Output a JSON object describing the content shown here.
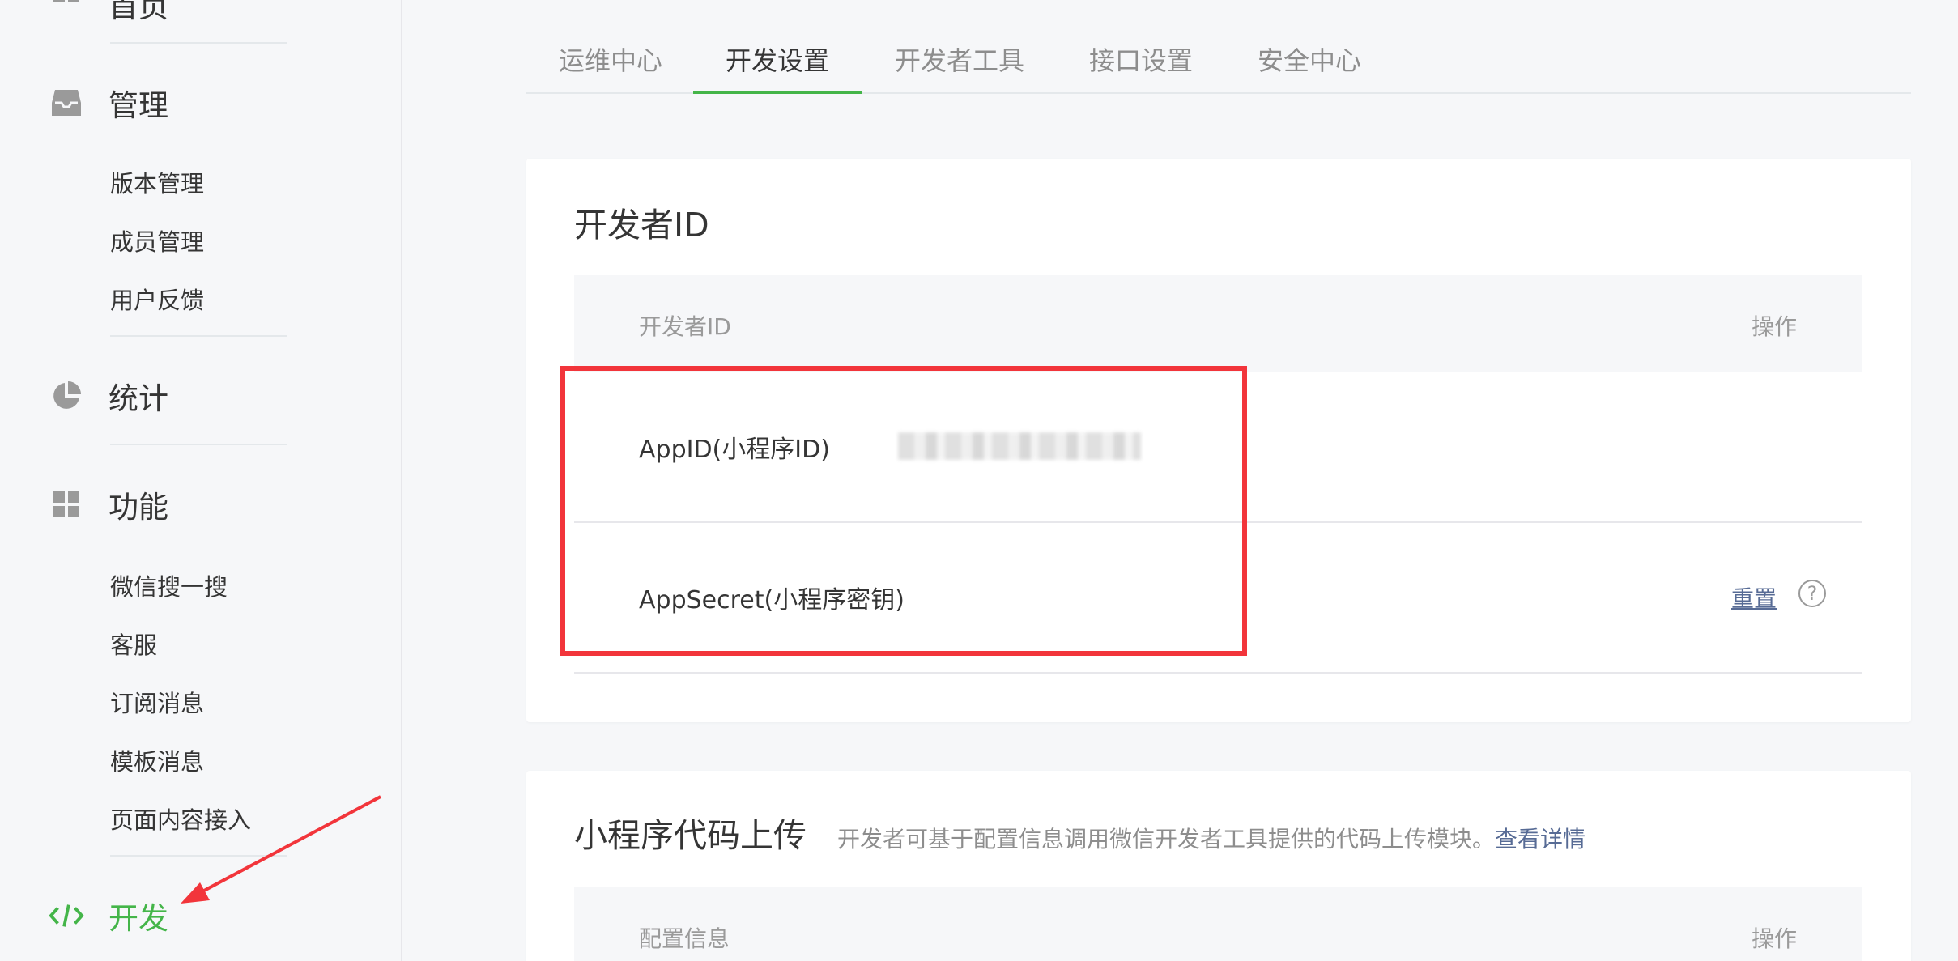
{
  "sidebar": {
    "top_partial": "首页",
    "sections": [
      {
        "label": "管理",
        "subs": [
          "版本管理",
          "成员管理",
          "用户反馈"
        ]
      },
      {
        "label": "统计"
      },
      {
        "label": "功能",
        "subs": [
          "微信搜一搜",
          "客服",
          "订阅消息",
          "模板消息",
          "页面内容接入"
        ]
      },
      {
        "label": "开发"
      }
    ]
  },
  "tabs": [
    "运维中心",
    "开发设置",
    "开发者工具",
    "接口设置",
    "安全中心"
  ],
  "dev_id_card": {
    "title": "开发者ID",
    "col_header": "开发者ID",
    "col_action": "操作",
    "rows": [
      {
        "label": "AppID(小程序ID)"
      },
      {
        "label": "AppSecret(小程序密钥)",
        "action": "重置",
        "help": "?"
      }
    ]
  },
  "upload_card": {
    "title": "小程序代码上传",
    "desc": "开发者可基于配置信息调用微信开发者工具提供的代码上传模块。",
    "link": "查看详情",
    "col_header": "配置信息",
    "col_action": "操作"
  },
  "colors": {
    "accent": "#44b549",
    "link": "#576b95",
    "highlight": "#f2353b"
  }
}
